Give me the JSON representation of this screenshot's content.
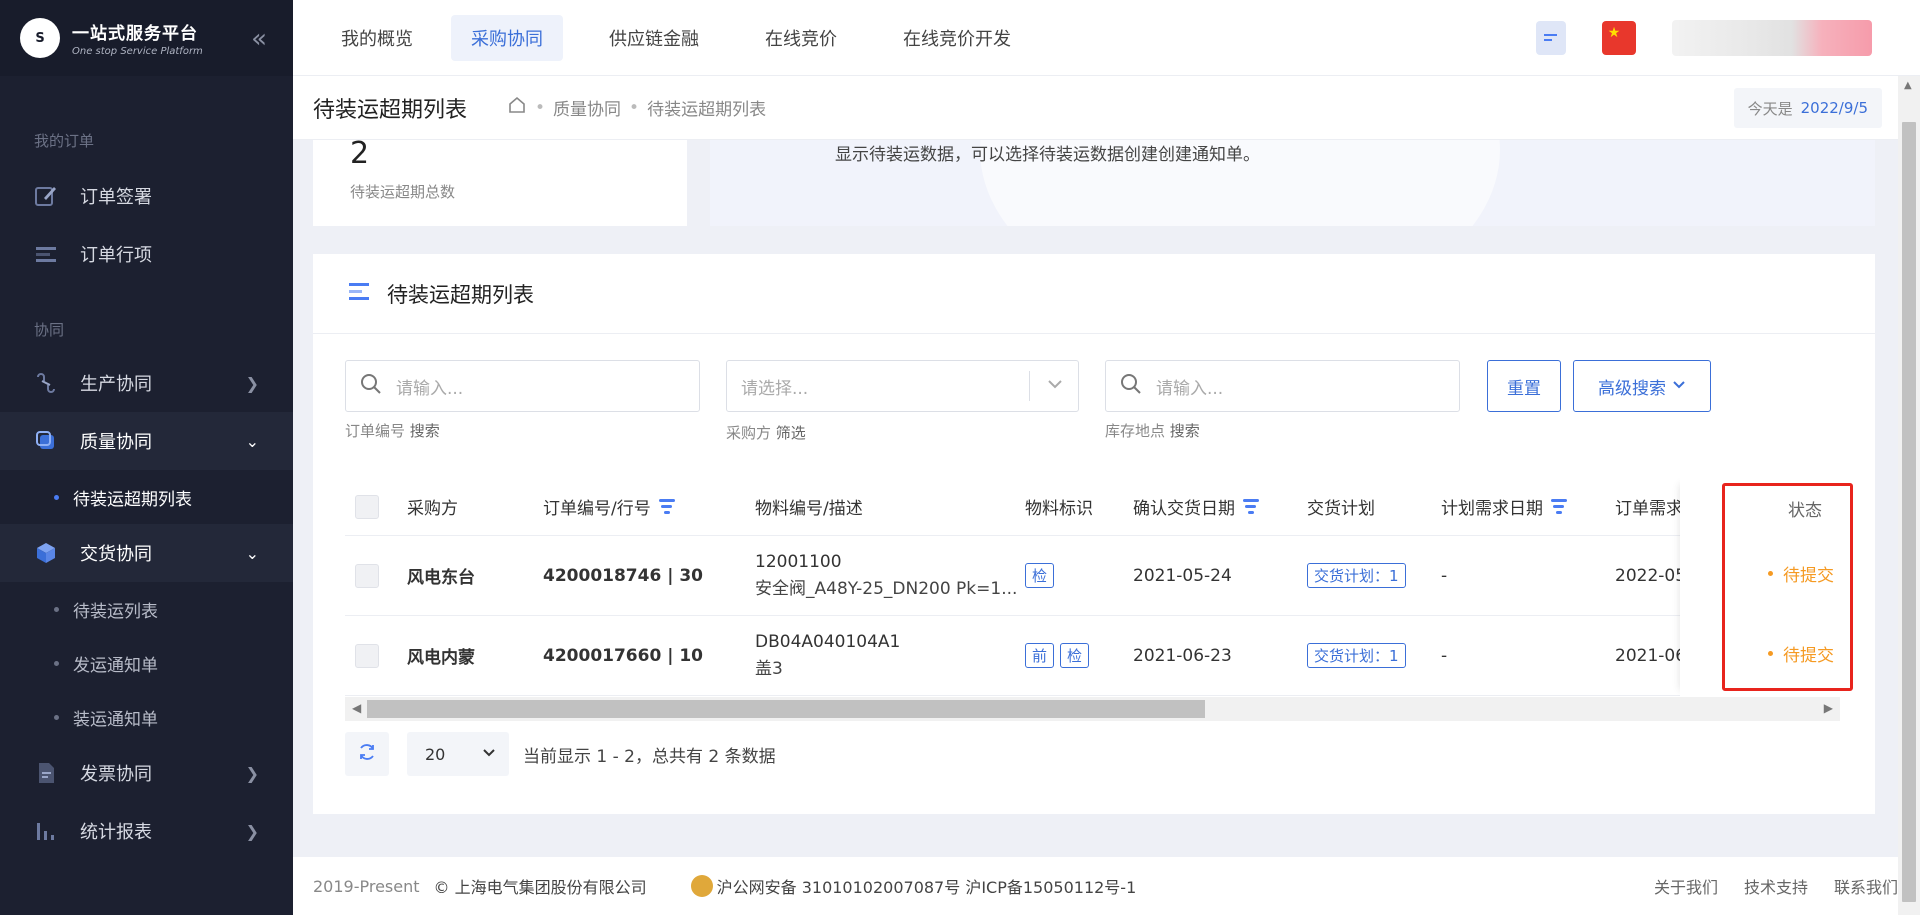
{
  "brand": {
    "title": "一站式服务平台",
    "subtitle": "One stop Service Platform",
    "mark": "上海电气"
  },
  "sidebar": {
    "section_orders": "我的订单",
    "section_collab": "协同",
    "items": [
      {
        "label": "订单签署",
        "icon": "edit-icon"
      },
      {
        "label": "订单行项",
        "icon": "list-icon"
      },
      {
        "label": "生产协同",
        "icon": "link-icon"
      },
      {
        "label": "质量协同",
        "icon": "quality-icon"
      },
      {
        "label": "交货协同",
        "icon": "cube-icon"
      },
      {
        "label": "发票协同",
        "icon": "document-icon"
      },
      {
        "label": "统计报表",
        "icon": "bar-chart-icon"
      }
    ],
    "sub_quality": [
      "待装运超期列表"
    ],
    "sub_delivery": [
      "待装运列表",
      "发运通知单",
      "装运通知单"
    ]
  },
  "topnav": {
    "tabs": [
      "我的概览",
      "采购协同",
      "供应链金融",
      "在线竞价",
      "在线竞价开发"
    ],
    "active": "采购协同"
  },
  "page": {
    "title": "待装运超期列表",
    "breadcrumb": [
      "质量协同",
      "待装运超期列表"
    ],
    "today_label": "今天是",
    "today_value": "2022/9/5"
  },
  "stat": {
    "value": "2",
    "label": "待装运超期总数"
  },
  "info": {
    "text": "显示待装运数据，可以选择待装运数据创建创建通知单。"
  },
  "card": {
    "title": "待装运超期列表"
  },
  "filters": {
    "order": {
      "placeholder": "请输入...",
      "caption_field": "订单编号",
      "caption_action": "搜索"
    },
    "buyer": {
      "placeholder": "请选择...",
      "caption_field": "采购方",
      "caption_action": "筛选"
    },
    "location": {
      "placeholder": "请输入...",
      "caption_field": "库存地点",
      "caption_action": "搜索"
    },
    "reset_label": "重置",
    "advanced_label": "高级搜索"
  },
  "table": {
    "columns": [
      "采购方",
      "订单编号/行号",
      "物料编号/描述",
      "物料标识",
      "确认交货日期",
      "交货计划",
      "计划需求日期",
      "订单需求",
      "状态"
    ],
    "rows": [
      {
        "buyer": "风电东台",
        "order": "4200018746 | 30",
        "material_no": "12001100",
        "material_desc": "安全阀_A48Y-25_DN200 Pk=1...",
        "tags": [
          "检"
        ],
        "confirm_date": "2021-05-24",
        "plan": "交货计划：1",
        "plan_date": "-",
        "need_date": "2022-05-",
        "status": "待提交"
      },
      {
        "buyer": "风电内蒙",
        "order": "4200017660 | 10",
        "material_no": "DB04A040104A1",
        "material_desc": "盖3",
        "tags": [
          "前",
          "检"
        ],
        "confirm_date": "2021-06-23",
        "plan": "交货计划：1",
        "plan_date": "-",
        "need_date": "2021-06-",
        "status": "待提交"
      }
    ]
  },
  "pager": {
    "size": "20",
    "info": "当前显示 1 - 2，总共有 2 条数据"
  },
  "footer": {
    "year": "2019-Present",
    "copyright": "© 上海电气集团股份有限公司",
    "police": "沪公网安备 31010102007087号",
    "icp": "沪ICP备15050112号-1",
    "links": [
      "关于我们",
      "技术支持",
      "联系我们"
    ]
  },
  "colors": {
    "sidebar_bg": "#1c2030",
    "accent": "#3b6fd8",
    "status": "#f59a23",
    "highlight": "#e8241d"
  }
}
